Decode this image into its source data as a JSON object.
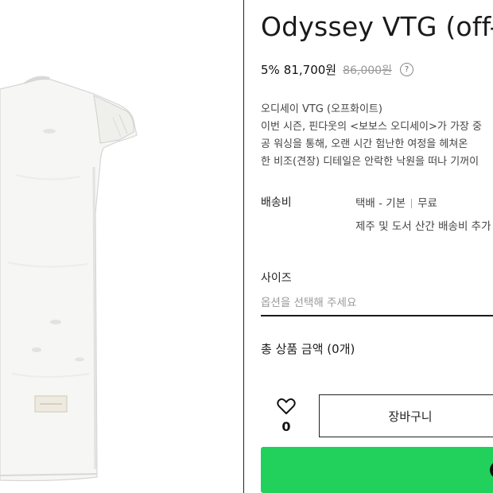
{
  "product": {
    "title": "Odyssey VTG (off-w",
    "discount": "5%",
    "price": "81,700원",
    "original_price": "86,000원",
    "help_icon": "?"
  },
  "description": {
    "lines": [
      "오디세이 VTG (오프화이트)",
      "이번 시즌, 핀다웃의 <보보스 오디세이>가 가장 중",
      "공 워싱을 통해, 오랜 시간 험난한 여정을 헤쳐온 ",
      "한 비조(견장) 디테일은 안락한 낙원을 떠나 기꺼이"
    ]
  },
  "shipping": {
    "label": "배송비",
    "method": "택배 - 기본",
    "fee": "무료",
    "note": "제주 및 도서 산간 배송비 추가"
  },
  "size": {
    "label": "사이즈",
    "placeholder": "옵션을 선택해 주세요"
  },
  "total": {
    "label": "총 상품 금액 (0개)"
  },
  "wishlist": {
    "count": "0"
  },
  "actions": {
    "cart_label": "장바구니"
  },
  "colors": {
    "buy_button": "#21d15b",
    "divider": "#222222"
  }
}
